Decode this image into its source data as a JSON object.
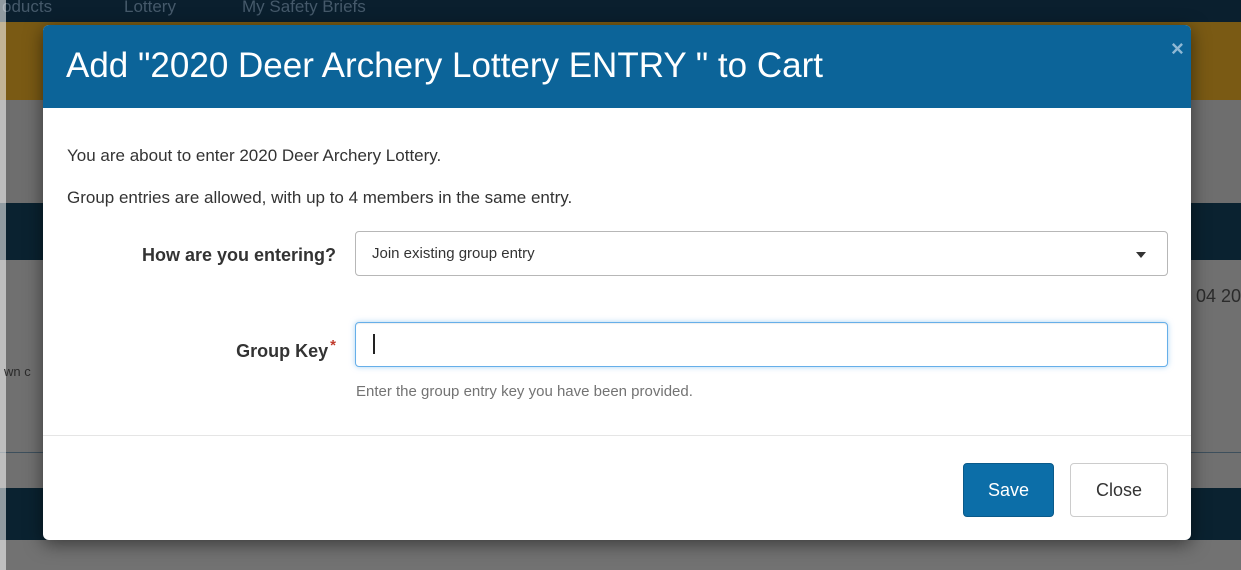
{
  "background": {
    "nav_items": [
      "oducts",
      "Lottery",
      "My Safety Briefs"
    ],
    "right_snippet": "04 20",
    "left_snippet": "wn c"
  },
  "modal": {
    "title": "Add \"2020 Deer Archery Lottery ENTRY \" to Cart",
    "close_icon": "×",
    "intro_line1": "You are about to enter 2020 Deer Archery Lottery.",
    "intro_line2": "Group entries are allowed, with up to 4 members in the same entry.",
    "entry_type": {
      "label": "How are you entering?",
      "selected": "Join existing group entry"
    },
    "group_key": {
      "label": "Group Key",
      "required_marker": "*",
      "value": "",
      "help": "Enter the group entry key you have been provided."
    },
    "buttons": {
      "save": "Save",
      "close": "Close"
    }
  },
  "colors": {
    "header_bg": "#0c6499",
    "primary_button": "#0c6ea8",
    "focus_border": "#66afe9",
    "required": "#c0392b"
  }
}
